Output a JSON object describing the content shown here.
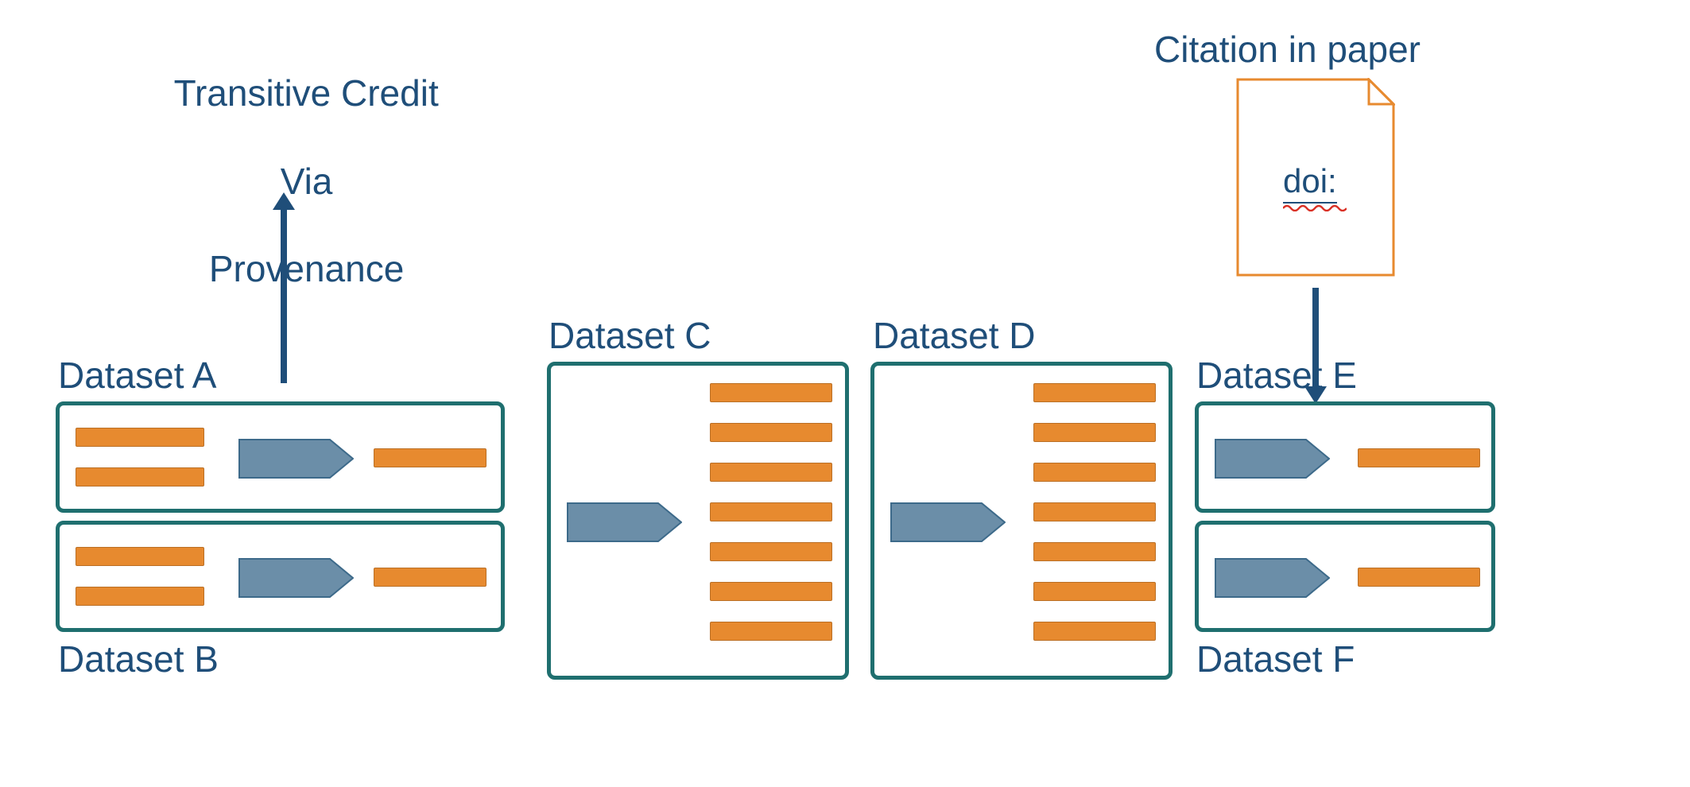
{
  "colors": {
    "text": "#1f4e79",
    "boxBorder": "#1f6f6f",
    "bar": "#e78a2f",
    "pentFill": "#6b8ea8",
    "pentStroke": "#3d6a8a",
    "docStroke": "#e78a2f"
  },
  "labels": {
    "transitive_line1": "Transitive Credit",
    "transitive_line2": "Via",
    "transitive_line3": "Provenance",
    "citation": "Citation in paper",
    "doi": "doi:",
    "datasetA": "Dataset A",
    "datasetB": "Dataset B",
    "datasetC": "Dataset C",
    "datasetD": "Dataset D",
    "datasetE": "Dataset E",
    "datasetF": "Dataset F"
  }
}
